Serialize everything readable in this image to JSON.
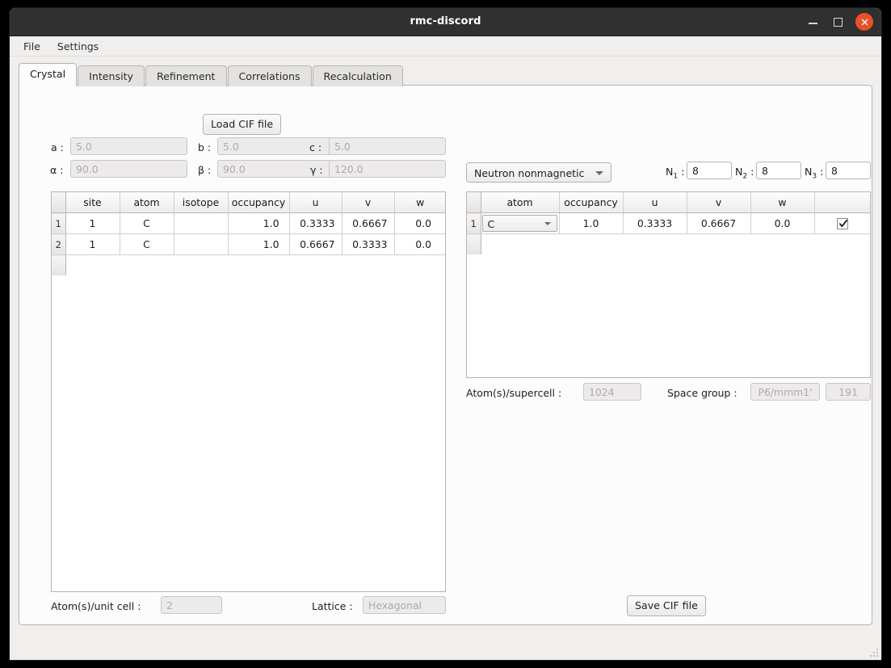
{
  "window": {
    "title": "rmc-discord",
    "controls": {
      "minimize": "minimize-button",
      "maximize": "maximize-button",
      "close": "close-button"
    }
  },
  "menubar": {
    "items": [
      {
        "label": "File"
      },
      {
        "label": "Settings"
      }
    ]
  },
  "tabs": [
    {
      "label": "Crystal",
      "active": true
    },
    {
      "label": "Intensity",
      "active": false
    },
    {
      "label": "Refinement",
      "active": false
    },
    {
      "label": "Correlations",
      "active": false
    },
    {
      "label": "Recalculation",
      "active": false
    }
  ],
  "left_pane": {
    "load_button": "Load CIF file",
    "lattice_params": [
      {
        "label": "a :",
        "value": "5.0",
        "disabled": true
      },
      {
        "label": "b :",
        "value": "5.0",
        "disabled": true
      },
      {
        "label": "c :",
        "value": "5.0",
        "disabled": true
      },
      {
        "label": "α :",
        "value": "90.0",
        "disabled": true
      },
      {
        "label": "β :",
        "value": "90.0",
        "disabled": true
      },
      {
        "label": "γ :",
        "value": "120.0",
        "disabled": true
      }
    ],
    "table": {
      "headers": [
        "site",
        "atom",
        "isotope",
        "occupancy",
        "u",
        "v",
        "w"
      ],
      "rows": [
        {
          "index": "1",
          "cells": [
            "1",
            "C",
            "",
            "1.0",
            "0.3333",
            "0.6667",
            "0.0"
          ]
        },
        {
          "index": "2",
          "cells": [
            "1",
            "C",
            "",
            "1.0",
            "0.6667",
            "0.3333",
            "0.0"
          ]
        }
      ]
    },
    "footer": {
      "atoms_unit_cell_label": "Atom(s)/unit cell :",
      "atoms_unit_cell_value": "2",
      "lattice_label": "Lattice :",
      "lattice_value": "Hexagonal"
    }
  },
  "right_pane": {
    "scattering_combo": "Neutron nonmagnetic",
    "supercell": [
      {
        "label": "N",
        "sub": "1",
        "sep": " :",
        "value": "8"
      },
      {
        "label": "N",
        "sub": "2",
        "sep": " :",
        "value": "8"
      },
      {
        "label": "N",
        "sub": "3",
        "sep": " :",
        "value": "8"
      }
    ],
    "table": {
      "headers": [
        "atom",
        "occupancy",
        "u",
        "v",
        "w",
        ""
      ],
      "rows": [
        {
          "index": "1",
          "atom": "C",
          "occupancy": "1.0",
          "u": "0.3333",
          "v": "0.6667",
          "w": "0.0",
          "checked": true
        }
      ]
    },
    "footer": {
      "atoms_supercell_label": "Atom(s)/supercell :",
      "atoms_supercell_value": "1024",
      "space_group_label": "Space group :",
      "space_group_symbol": "P6/mmm1'",
      "space_group_number": "191"
    },
    "save_button": "Save CIF file"
  },
  "colors": {
    "titlebar": "#303030",
    "close_button": "#e8502a",
    "window_background": "#f0efee",
    "page_background": "#fcfcfc"
  }
}
